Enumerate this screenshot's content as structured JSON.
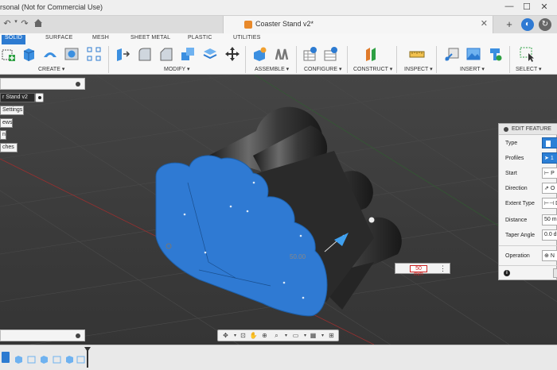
{
  "app": {
    "title_fragment": "rsonal (Not for Commercial Use)",
    "window_controls": [
      "—",
      "☐",
      "✕"
    ]
  },
  "document": {
    "title": "Coaster Stand v2*",
    "close_glyph": "✕",
    "add_glyph": "+"
  },
  "ribbon": {
    "tabs": [
      "SOLID",
      "SURFACE",
      "MESH",
      "SHEET METAL",
      "PLASTIC",
      "UTILITIES"
    ],
    "active_tab": "SOLID",
    "groups": {
      "create": "CREATE ▾",
      "modify": "MODIFY ▾",
      "assemble": "ASSEMBLE ▾",
      "configure": "CONFIGURE ▾",
      "construct": "CONSTRUCT ▾",
      "inspect": "INSPECT ▾",
      "insert": "INSERT ▾",
      "select": "SELECT ▾"
    }
  },
  "browser": {
    "root": "r Stand v2",
    "items": [
      "Settings",
      "ews",
      "n",
      "ches"
    ]
  },
  "viewport": {
    "dimension_text": "50.00"
  },
  "distance_input": {
    "value": "50 mm",
    "more": "⋮"
  },
  "edit_feature": {
    "title": "EDIT FEATURE",
    "rows": [
      {
        "label": "Type",
        "value": ""
      },
      {
        "label": "Profiles",
        "value": "1"
      },
      {
        "label": "Start",
        "value": "P"
      },
      {
        "label": "Direction",
        "value": "O"
      },
      {
        "label": "Extent Type",
        "value": "D"
      },
      {
        "label": "Distance",
        "value": "50 m"
      },
      {
        "label": "Taper Angle",
        "value": "0.0 d"
      },
      {
        "label": "Operation",
        "value": "N"
      }
    ],
    "info_glyph": "i"
  },
  "colors": {
    "accent": "#2d7bd1",
    "profile_blue": "#2f7ad3",
    "body_dark": "#2e2e2e"
  }
}
